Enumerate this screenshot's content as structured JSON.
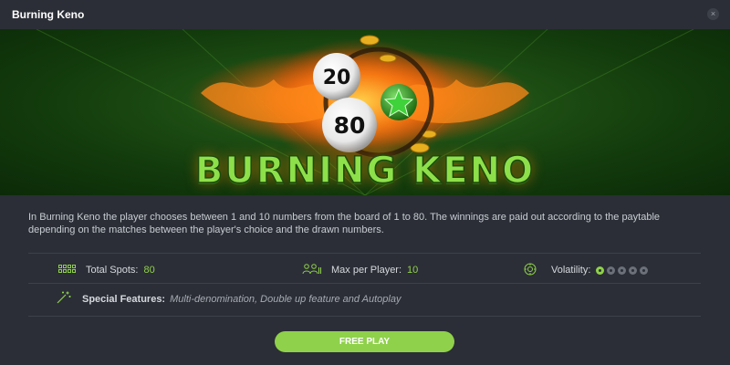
{
  "window": {
    "title": "Burning Keno",
    "close_symbol": "×"
  },
  "banner": {
    "logo_text": "BURNING KENO",
    "ball_numbers": [
      "20",
      "80"
    ]
  },
  "description": "In Burning Keno the player chooses between 1 and 10 numbers from the board of 1 to 80. The winnings are paid out according to the paytable depending on the matches between the player's choice and the drawn numbers.",
  "stats": {
    "total_spots": {
      "label": "Total Spots:",
      "value": "80",
      "icon": "grid-icon"
    },
    "max_per_player": {
      "label": "Max per Player:",
      "value": "10",
      "icon": "players-icon"
    },
    "volatility": {
      "label": "Volatility:",
      "level": 1,
      "max": 5,
      "icon": "gauge-icon"
    }
  },
  "features": {
    "label": "Special Features:",
    "value": "Multi-denomination, Double up feature and Autoplay",
    "icon": "magic-wand-icon"
  },
  "actions": {
    "play_label": "FREE PLAY"
  },
  "colors": {
    "background": "#2b2e36",
    "accent": "#8fd14a",
    "divider": "#3d414a"
  }
}
